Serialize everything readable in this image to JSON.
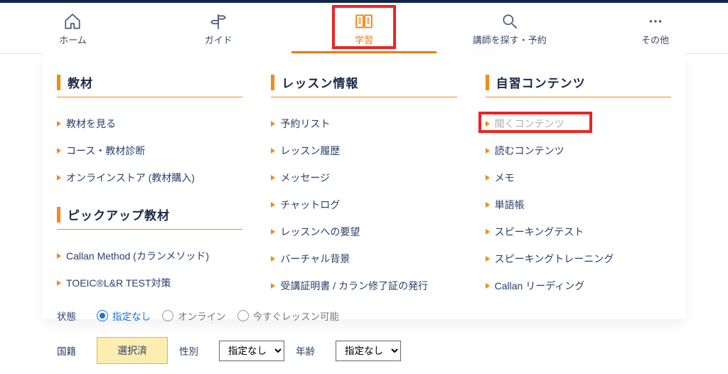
{
  "nav": {
    "items": [
      {
        "label": "ホーム"
      },
      {
        "label": "ガイド"
      },
      {
        "label": "学習"
      },
      {
        "label": "講師を探す・予約"
      },
      {
        "label": "その他"
      }
    ]
  },
  "dropdown": {
    "col1": {
      "section1": {
        "title": "教材",
        "items": [
          "教材を見る",
          "コース・教材診断",
          "オンラインストア (教材購入)"
        ]
      },
      "section2": {
        "title": "ピックアップ教材",
        "items": [
          "Callan Method (カランメソッド)",
          "TOEIC®L&R TEST対策"
        ]
      }
    },
    "col2": {
      "section1": {
        "title": "レッスン情報",
        "items": [
          "予約リスト",
          "レッスン履歴",
          "メッセージ",
          "チャットログ",
          "レッスンへの要望",
          "バーチャル背景",
          "受講証明書 / カラン修了証の発行"
        ]
      }
    },
    "col3": {
      "section1": {
        "title": "自習コンテンツ",
        "items": [
          "聞くコンテンツ",
          "読むコンテンツ",
          "メモ",
          "単語帳",
          "スピーキングテスト",
          "スピーキングトレーニング",
          "Callan リーディング"
        ]
      }
    }
  },
  "filters": {
    "status_label": "状態",
    "status_options": [
      "指定なし",
      "オンライン",
      "今すぐレッスン可能"
    ],
    "nationality_label": "国籍",
    "nationality_button": "選択済",
    "gender_label": "性別",
    "gender_selected": "指定なし",
    "age_label": "年齢",
    "age_selected": "指定なし"
  }
}
